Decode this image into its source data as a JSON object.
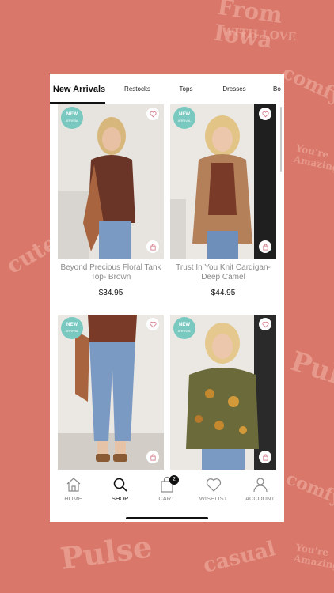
{
  "tabs": [
    {
      "label": "New Arrivals",
      "active": true
    },
    {
      "label": "Restocks"
    },
    {
      "label": "Tops"
    },
    {
      "label": "Dresses"
    },
    {
      "label": "Bo"
    }
  ],
  "badge": {
    "main": "NEW",
    "sub": "ARRIVAL"
  },
  "products": [
    {
      "name": "Beyond Precious Floral Tank Top- Brown",
      "price": "$34.95"
    },
    {
      "name": "Trust In You Knit Cardigan- Deep Camel",
      "price": "$44.95"
    },
    {
      "name": "",
      "price": ""
    },
    {
      "name": "",
      "price": ""
    }
  ],
  "nav": {
    "home": "HOME",
    "shop": "SHOP",
    "cart": "CART",
    "cart_count": "2",
    "wishlist": "WISHLIST",
    "account": "ACCOUNT"
  },
  "background_words": [
    "From Iowa",
    "WITH LOVE",
    "comfy",
    "You're Amazing",
    "cute",
    "Pulse",
    "casual"
  ],
  "colors": {
    "background": "#d9786a",
    "badge": "#79c9c1"
  }
}
